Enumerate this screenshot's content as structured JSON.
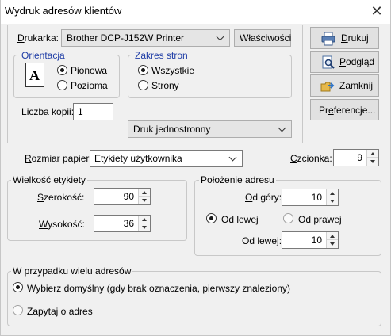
{
  "window": {
    "title": "Wydruk adresów klientów",
    "close": "✕"
  },
  "printer": {
    "label_prefix": "D",
    "label_rest": "rukarka:",
    "selected": "Brother DCP-J152W Printer",
    "properties_button": "Właściwości"
  },
  "orientation": {
    "legend": "Orientacja",
    "icon_letter": "A",
    "options": [
      {
        "label": "Pionowa",
        "selected": true
      },
      {
        "label": "Pozioma",
        "selected": false
      }
    ]
  },
  "page_range": {
    "legend": "Zakres stron",
    "options": [
      {
        "label": "Wszystkie",
        "selected": true
      },
      {
        "label": "Strony",
        "selected": false
      }
    ]
  },
  "copies": {
    "label_prefix": "L",
    "label_rest": "iczba kopii:",
    "value": "1"
  },
  "duplex": {
    "selected": "Druk jednostronny"
  },
  "buttons": {
    "print": {
      "prefix": "D",
      "rest": "rukuj"
    },
    "preview": {
      "prefix": "P",
      "rest": "odgląd"
    },
    "close": {
      "prefix": "Z",
      "rest": "amknij"
    },
    "preferences": {
      "prefix": "Pr",
      "mid": "e",
      "rest": "ferencje..."
    }
  },
  "paper_size": {
    "label_prefix": "R",
    "label_rest": "ozmiar papieru:",
    "selected": "Etykiety użytkownika"
  },
  "font": {
    "label_prefix": "C",
    "label_rest": "zcionka:",
    "value": "9"
  },
  "label_size": {
    "legend": "Wielkość etykiety",
    "width": {
      "label_prefix": "S",
      "label_rest": "zerokość:",
      "value": "90"
    },
    "height": {
      "label_prefix": "W",
      "label_rest": "ysokość:",
      "value": "36"
    }
  },
  "address_position": {
    "legend": "Położenie adresu",
    "top": {
      "label_prefix": "O",
      "label_rest": "d góry:",
      "value": "10"
    },
    "from_left_option": {
      "label": "Od lewej",
      "selected": true
    },
    "from_right_option": {
      "label": "Od prawej",
      "selected": false
    },
    "left": {
      "label": "Od lewej:",
      "value": "10"
    }
  },
  "multiple_addresses": {
    "legend": "W przypadku wielu adresów",
    "options": [
      {
        "label": "Wybierz domyślny (gdy brak oznaczenia, pierwszy znaleziony)",
        "selected": true
      },
      {
        "label": "Zapytaj o adres",
        "selected": false
      }
    ]
  },
  "colors": {
    "legend_blue": "#1f3da6",
    "background": "#f0f0f0"
  }
}
